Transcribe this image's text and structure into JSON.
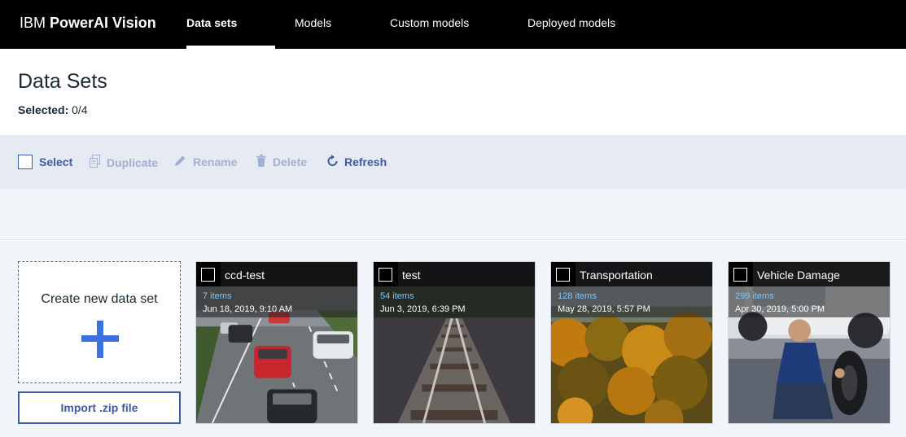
{
  "app": {
    "brand_prefix": "IBM",
    "brand_name": "PowerAI Vision"
  },
  "nav": {
    "tabs": [
      {
        "label": "Data sets",
        "active": true
      },
      {
        "label": "Models",
        "active": false
      },
      {
        "label": "Custom models",
        "active": false
      },
      {
        "label": "Deployed models",
        "active": false
      }
    ]
  },
  "page": {
    "title": "Data Sets",
    "selected_label": "Selected:",
    "selected_value": "0/4"
  },
  "toolbar": {
    "select_label": "Select",
    "duplicate_label": "Duplicate",
    "rename_label": "Rename",
    "delete_label": "Delete",
    "refresh_label": "Refresh"
  },
  "create_card": {
    "label": "Create new data set",
    "import_label": "Import .zip file"
  },
  "datasets": [
    {
      "name": "ccd-test",
      "count": "7 items",
      "date": "Jun 18, 2019, 9:10 AM"
    },
    {
      "name": "test",
      "count": "54 items",
      "date": "Jun 3, 2019, 6:39 PM"
    },
    {
      "name": "Transportation",
      "count": "128 items",
      "date": "May 28, 2019, 5:57 PM"
    },
    {
      "name": "Vehicle Damage",
      "count": "299 items",
      "date": "Apr 30, 2019, 5:00 PM"
    }
  ],
  "colors": {
    "accent": "#3d5aa9",
    "plus": "#3d70e0",
    "item_count": "#7cc7ff",
    "topbar": "#000000"
  }
}
